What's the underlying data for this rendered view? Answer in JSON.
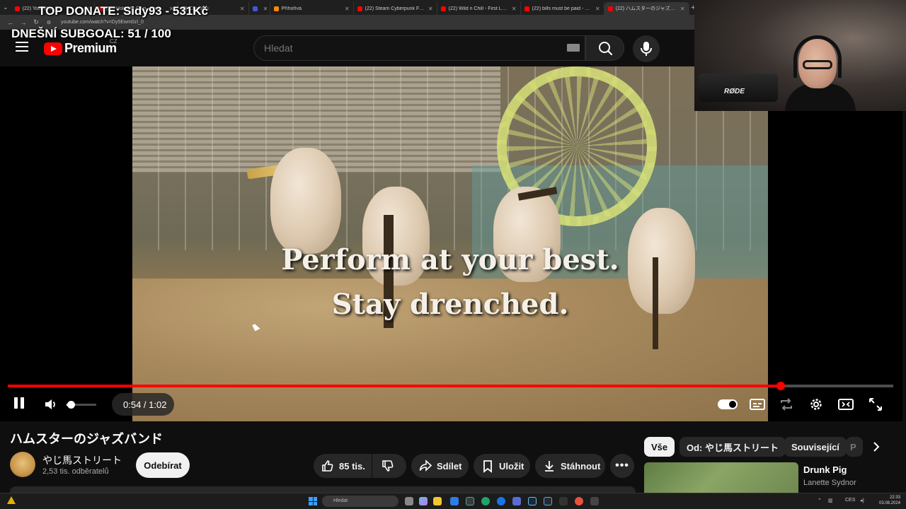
{
  "browser": {
    "tabs": [
      {
        "title": "(22) YouTube",
        "color": "#ff0000"
      },
      {
        "title": "(22) Hold Me Own - YouTube",
        "color": "#ff0000"
      },
      {
        "title": "Chatless",
        "color": "#8a8a8a"
      },
      {
        "title": "",
        "color": "#3b5bdb"
      },
      {
        "title": "Příhořívá",
        "color": "#ff8a00"
      },
      {
        "title": "(22) Steam Cyberpunk Fest 2024",
        "color": "#ff0000"
      },
      {
        "title": "(22) Wild n Chill - First Look Ga",
        "color": "#ff0000"
      },
      {
        "title": "(22) bills must be paid - YouTub",
        "color": "#ff0000"
      },
      {
        "title": "(22) ハムスターのジャズバンド -",
        "color": "#ff0000"
      }
    ],
    "url": "youtube.com/watch?v=Dy5Ewm0zI_0"
  },
  "overlay": {
    "top_donate": "TOP DONATE: Sidy93 - 531Kč",
    "subgoal": "DNEŠNÍ SUBGOAL: 51 / 100"
  },
  "header": {
    "logo_text": "Premium",
    "country_code": "CZ",
    "search_placeholder": "Hledat"
  },
  "player": {
    "caption_line1": "Perform at your best.",
    "caption_line2": "Stay drenched.",
    "time": "0:54 / 1:02",
    "progress": 0.873,
    "volume": 0.15,
    "accent": "#ff0000"
  },
  "webcam": {
    "mic_brand": "RØDE"
  },
  "video": {
    "title": "ハムスターのジャズバンド",
    "channel": "やじ馬ストリート",
    "subscribers": "2,53 tis. odběratelů",
    "subscribe_label": "Odebírat",
    "likes": "85 tis.",
    "share_label": "Sdílet",
    "save_label": "Uložit",
    "download_label": "Stáhnout"
  },
  "sidebar": {
    "chips": [
      "Vše",
      "Od: やじ馬ストリート",
      "Související",
      "P"
    ],
    "recommendation": {
      "title": "Drunk Pig",
      "channel": "Lanette Sydnor"
    }
  },
  "taskbar": {
    "search_placeholder": "Hledat",
    "language": "CES",
    "time": "22:33",
    "date": "03.08.2024"
  }
}
